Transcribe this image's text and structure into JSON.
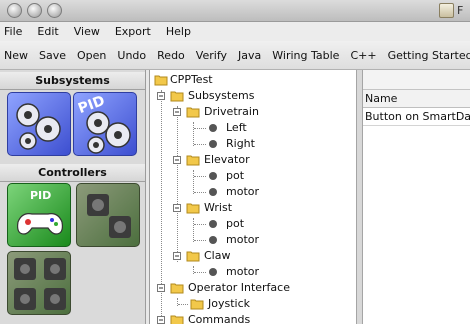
{
  "window": {
    "title": "F"
  },
  "menu": [
    "File",
    "Edit",
    "View",
    "Export",
    "Help"
  ],
  "toolbar": [
    "New",
    "Save",
    "Open",
    "Undo",
    "Redo",
    "Verify",
    "Java",
    "Wiring Table",
    "C++",
    "Getting Started"
  ],
  "palette": {
    "subsystems_label": "Subsystems",
    "controllers_label": "Controllers",
    "subsystem_tiles": [
      {
        "icon": "gears-icon",
        "label": ""
      },
      {
        "icon": "pid-subsystem-icon",
        "label": "PID"
      }
    ],
    "controller_tiles": [
      {
        "icon": "pid-gamepad-icon",
        "label": "PID"
      },
      {
        "icon": "joystick-icon",
        "label": ""
      },
      {
        "icon": "joysticks-icon",
        "label": ""
      }
    ]
  },
  "tree": {
    "root": "CPPTest",
    "subsystems": "Subsystems",
    "drivetrain": "Drivetrain",
    "left": "Left",
    "right": "Right",
    "elevator": "Elevator",
    "elevator_pot": "pot",
    "elevator_motor": "motor",
    "wrist": "Wrist",
    "wrist_pot": "pot",
    "wrist_motor": "motor",
    "claw": "Claw",
    "claw_motor": "motor",
    "operator_interface": "Operator Interface",
    "joystick": "Joystick",
    "commands": "Commands"
  },
  "properties": {
    "column_name": "Name",
    "row_value": "Button on SmartDashb"
  }
}
